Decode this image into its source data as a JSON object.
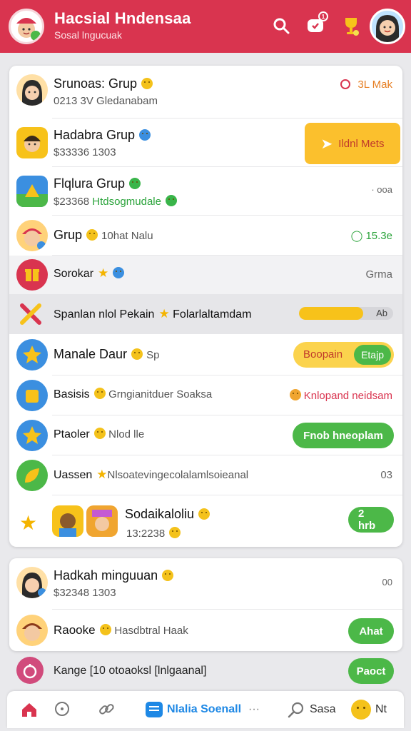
{
  "app": {
    "title": "Hacsial Hndensaa",
    "subtitle": "Sosal lngucuak",
    "accent": "#d9344f",
    "notification_count": "1"
  },
  "group_card_1": {
    "header": {
      "name": "Srunoas: Grup",
      "sub": "0213 3V Gledanabam",
      "meta": "3L Mak"
    },
    "rows": [
      {
        "name": "Hadabra Grup",
        "sub": "$33336 1303",
        "action": "Ildnl Mets"
      },
      {
        "name": "Flqlura Grup",
        "sub_prefix": "$23368",
        "sub_green": "Htdsogmudale",
        "meta": "· ooa"
      },
      {
        "name": "Grup",
        "sub_inline": "10hat Nalu",
        "meta": "15.3e"
      },
      {
        "name": "Sorokar",
        "meta": "Grma"
      },
      {
        "name": "Spanlan nlol Pekain",
        "sub_inline": "Folarlaltamdam",
        "progress_label": "Ab",
        "progress_value": 0.68
      },
      {
        "name": "Manale Daur",
        "sub_inline": "Sp",
        "pill_left": "Boopain",
        "pill_right": "Etajp"
      },
      {
        "name": "Basisis",
        "sub_inline": "Grngianitduer Soaksa",
        "meta": "Knlopand neidsam"
      },
      {
        "name": "Ptaoler",
        "sub_inline": "Nlod lle",
        "action": "Fnob hneoplam"
      },
      {
        "name": "Uassen",
        "sub_inline": "Nlsoatevingecolalamlsoieanal",
        "meta": "03"
      },
      {
        "name": "Sodaikaloliu",
        "sub": "13:2238",
        "action": "2 hrb"
      }
    ]
  },
  "group_card_2": {
    "rows": [
      {
        "name": "Hadkah minguuan",
        "sub": "$32348 1303",
        "meta": "00"
      },
      {
        "name": "Raooke",
        "sub_inline": "Hasdbtral Haak",
        "action": "Ahat"
      }
    ]
  },
  "invite_row": {
    "label": "Kange [10 otoaoksl [lnlgaanal]",
    "action": "Paoct"
  },
  "bottom_nav": {
    "active_label": "Nlalia Soenall",
    "more": "···",
    "search_label": "Sasa",
    "profile_label": "Nt"
  }
}
